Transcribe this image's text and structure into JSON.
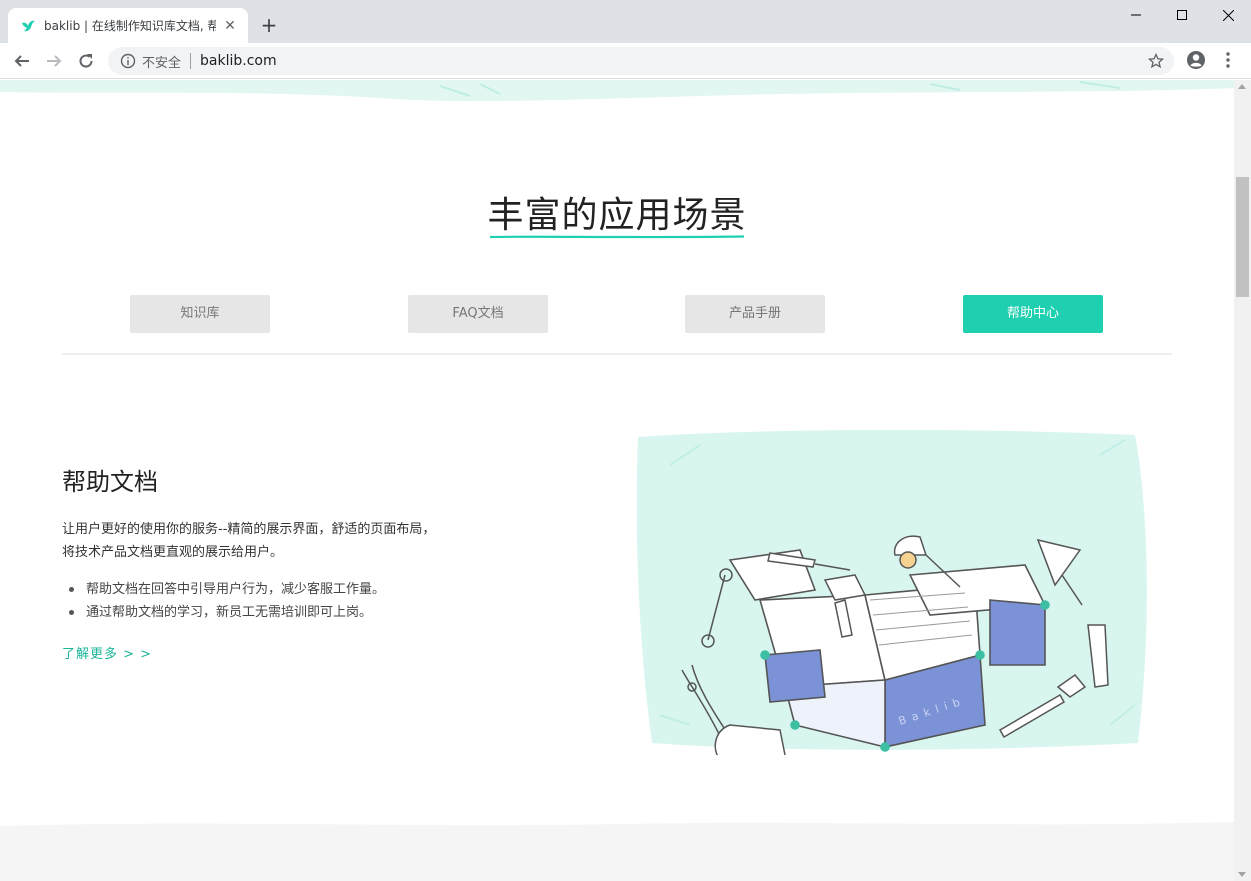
{
  "browser": {
    "tab_title": "baklib | 在线制作知识库文档, 帮",
    "new_tab_symbol": "+",
    "tab_close_symbol": "✕",
    "omnibox": {
      "security_label": "不安全",
      "url": "baklib.com"
    },
    "icons": {
      "favicon": "baklib-bird-icon",
      "back": "arrow-left-icon",
      "forward": "arrow-right-icon",
      "reload": "reload-icon",
      "info": "info-icon",
      "bookmark": "star-icon",
      "account": "account-icon",
      "menu": "kebab-menu-icon"
    }
  },
  "page": {
    "section_title": "丰富的应用场景",
    "tabs": [
      {
        "label": "知识库",
        "active": false
      },
      {
        "label": "FAQ文档",
        "active": false
      },
      {
        "label": "产品手册",
        "active": false
      },
      {
        "label": "帮助中心",
        "active": true
      }
    ],
    "content": {
      "heading": "帮助文档",
      "description_lines": [
        "让用户更好的使用你的服务--精简的展示界面，舒适的页面布局，",
        "将技术产品文档更直观的展示给用户。"
      ],
      "bullets": [
        "帮助文档在回答中引导用户行为，减少客服工作量。",
        "通过帮助文档的学习，新员工无需培训即可上岗。"
      ],
      "link_label": "了解更多 > >",
      "illustration_label": "Baklib"
    },
    "colors": {
      "accent": "#1ecfb0",
      "link": "#1ab59a",
      "illustration_bg": "#d8f6ef",
      "box_panel": "#7b92d6"
    }
  }
}
